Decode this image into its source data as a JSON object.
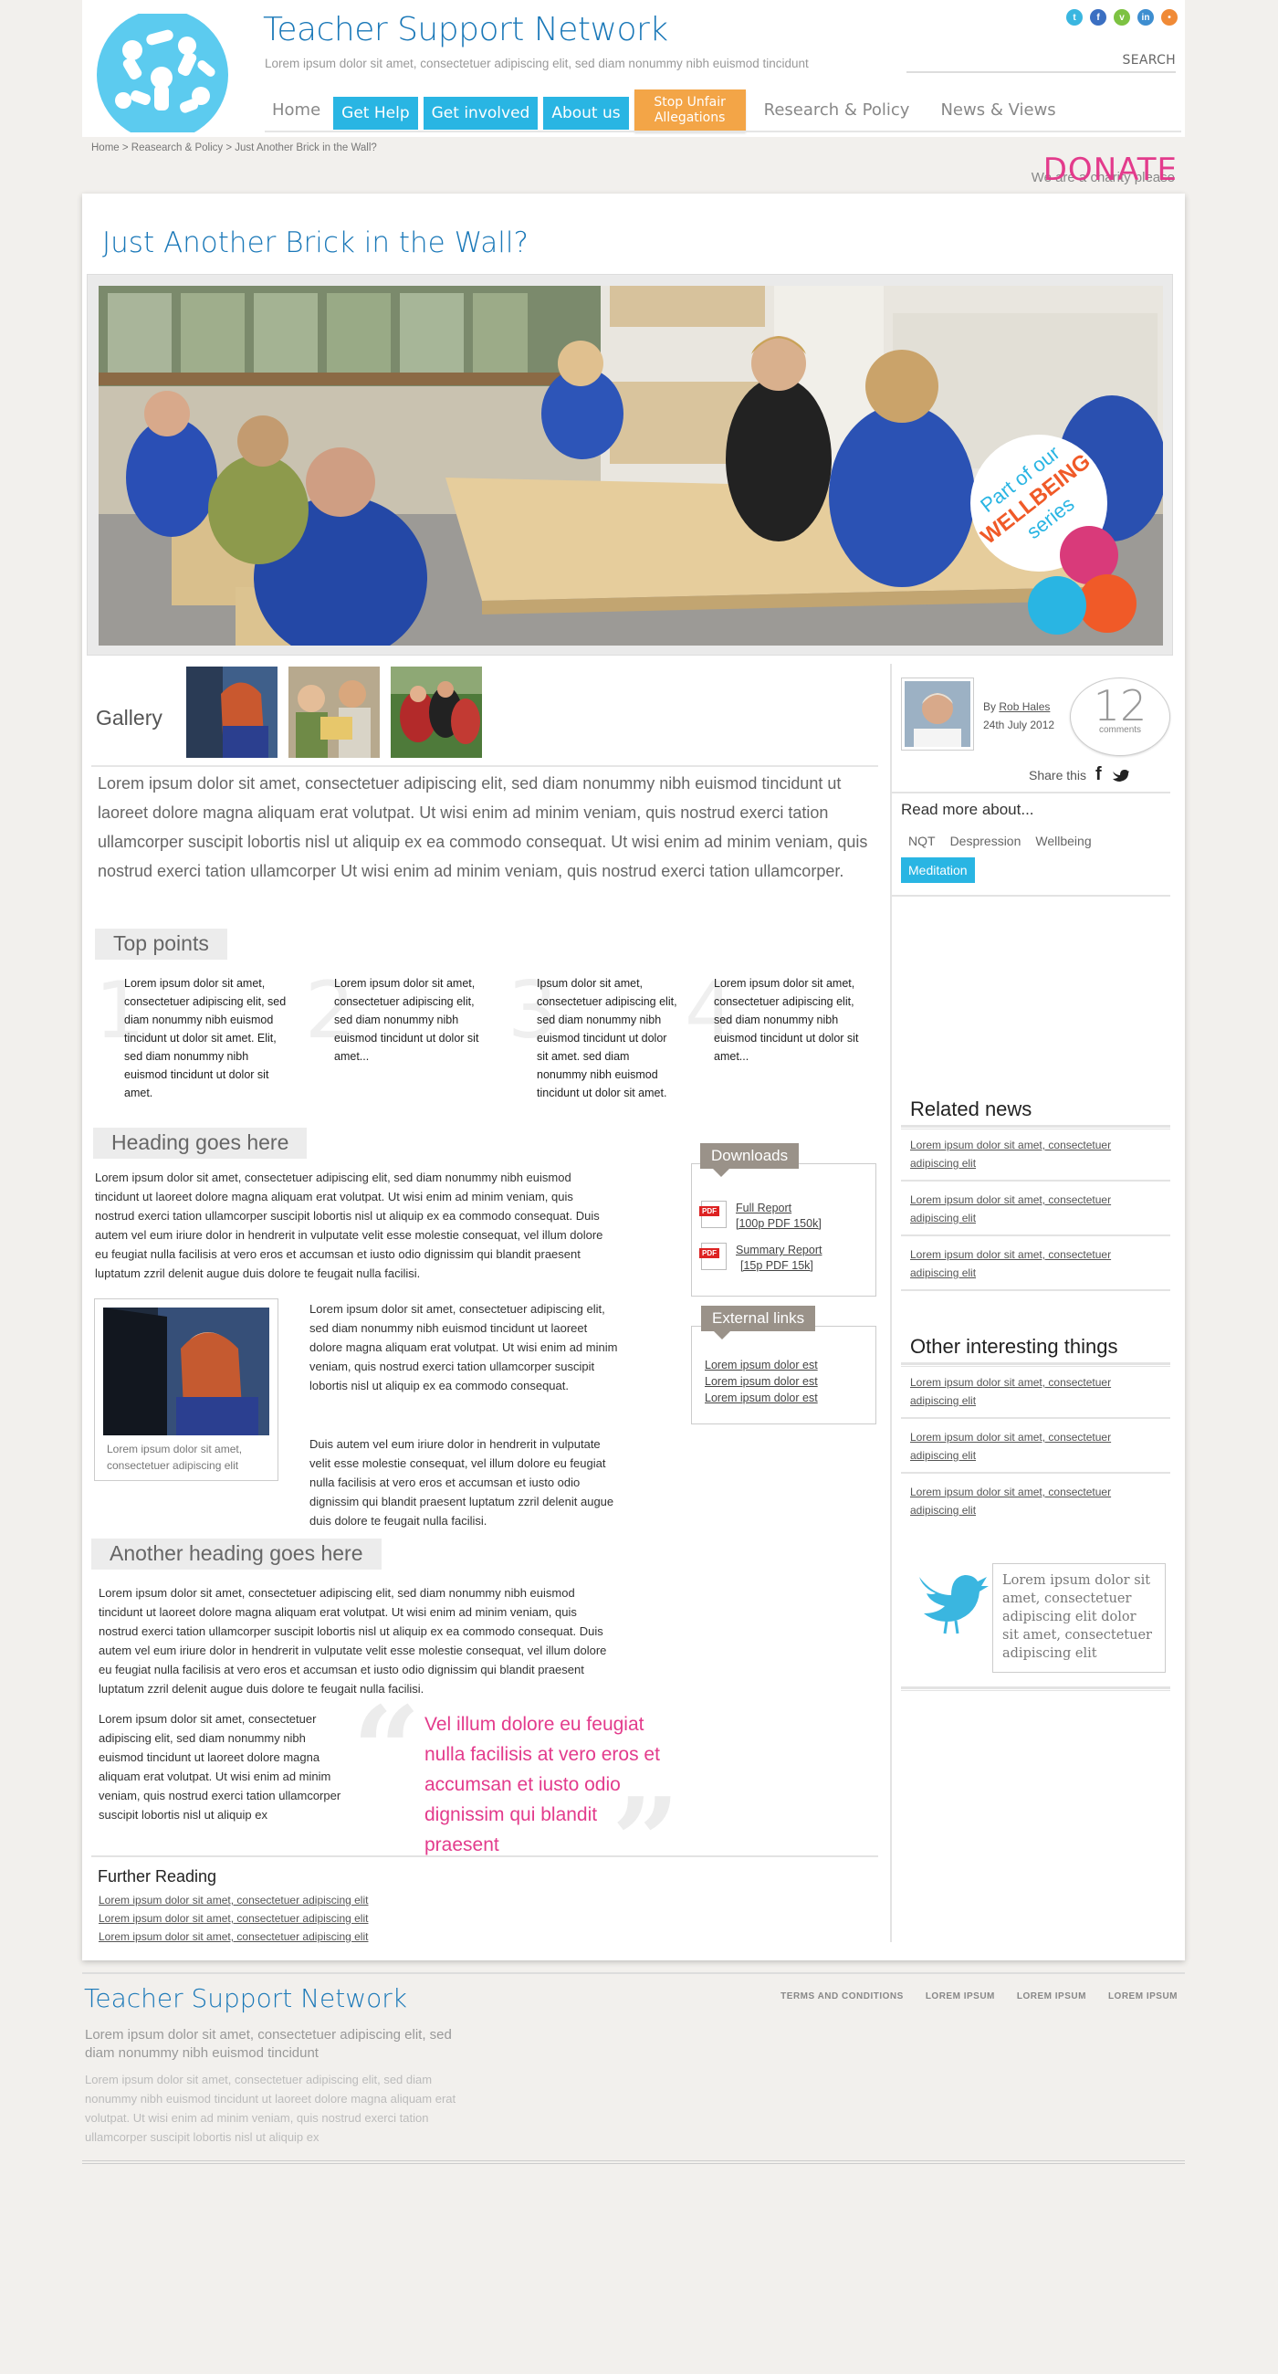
{
  "header": {
    "site_title": "Teacher Support Network",
    "tagline": "Lorem ipsum dolor sit amet, consectetuer adipiscing elit, sed diam nonummy nibh euismod tincidunt",
    "search_label": "SEARCH",
    "social_icons": [
      "twitter-icon",
      "facebook-icon",
      "vimeo-icon",
      "linkedin-icon",
      "rss-icon"
    ],
    "nav": [
      {
        "label": "Home",
        "style": "plain"
      },
      {
        "label": "Get Help",
        "style": "blue"
      },
      {
        "label": "Get involved",
        "style": "blue"
      },
      {
        "label": "About us",
        "style": "blue"
      },
      {
        "label": "Stop Unfair Allegations",
        "style": "orange"
      },
      {
        "label": "Research & Policy",
        "style": "plain"
      },
      {
        "label": "News & Views",
        "style": "plain"
      }
    ],
    "breadcrumb": "Home > Reasearch & Policy > Just Another Brick in the Wall?",
    "charity_text": "We are a charity please",
    "donate_label": "DONATE"
  },
  "colors": {
    "brand_blue": "#1a78b8",
    "accent_cyan": "#29b5e3",
    "accent_orange": "#f3a547",
    "accent_pink": "#e33b8c",
    "tag_grey": "#9a9289"
  },
  "article": {
    "title": "Just Another Brick in the Wall?",
    "hero_badge": {
      "line1": "Part of our",
      "line2": "WELLBEING",
      "line3": "series"
    },
    "gallery_label": "Gallery",
    "intro": "Lorem ipsum dolor sit amet, consectetuer adipiscing elit, sed diam nonummy nibh euismod tincidunt ut laoreet dolore magna aliquam erat volutpat. Ut wisi enim ad minim veniam, quis nostrud exerci tation ullamcorper suscipit lobortis nisl ut aliquip ex ea commodo consequat. Ut wisi enim ad minim veniam, quis nostrud exerci tation ullamcorper Ut wisi enim ad minim veniam, quis nostrud exerci tation ullamcorper.",
    "top_points_heading": "Top points",
    "top_points": [
      {
        "num": "1",
        "text": "Lorem ipsum dolor sit amet, consectetuer adipiscing elit, sed diam nonummy nibh euismod tincidunt ut  dolor sit amet. Elit, sed diam nonummy nibh euismod tincidunt ut dolor sit amet."
      },
      {
        "num": "2",
        "text": "Lorem ipsum dolor sit amet, consectetuer adipiscing elit, sed diam nonummy nibh euismod tincidunt ut  dolor sit amet..."
      },
      {
        "num": "3",
        "text": "Ipsum dolor sit amet, consectetuer adipiscing elit, sed diam nonummy nibh euismod tincidunt ut  dolor sit amet.  sed diam nonummy nibh euismod tincidunt ut  dolor sit amet."
      },
      {
        "num": "4",
        "text": "Lorem ipsum dolor sit amet, consectetuer adipiscing elit, sed diam nonummy nibh euismod tincidunt ut  dolor sit amet..."
      }
    ],
    "heading_2": "Heading goes here",
    "para_2": "Lorem ipsum dolor sit amet, consectetuer adipiscing elit, sed diam nonummy nibh euismod tincidunt ut laoreet dolore magna aliquam erat volutpat. Ut wisi enim ad minim veniam, quis nostrud exerci tation ullamcorper suscipit lobortis nisl ut aliquip ex ea commodo consequat. Duis autem vel eum iriure dolor in hendrerit in vulputate velit esse molestie consequat, vel illum dolore eu feugiat nulla facilisis at vero eros et accumsan et iusto odio dignissim qui blandit praesent luptatum zzril delenit augue duis dolore te feugait nulla facilisi.",
    "figure_caption": "Lorem ipsum dolor sit amet, consectetuer adipiscing elit",
    "para_3a": "Lorem ipsum dolor sit amet, consectetuer adipiscing elit, sed diam nonummy nibh euismod tincidunt ut laoreet dolore magna aliquam erat volutpat. Ut wisi enim ad minim veniam, quis nostrud exerci tation ullamcorper suscipit lobortis nisl ut aliquip ex ea commodo consequat.",
    "para_3b": "Duis autem vel eum iriure dolor in hendrerit in vulputate velit esse molestie consequat, vel illum dolore eu feugiat nulla facilisis at vero eros et accumsan et iusto odio dignissim qui blandit praesent luptatum zzril delenit augue duis dolore te feugait nulla facilisi.",
    "heading_3": "Another heading goes here",
    "para_4": "Lorem ipsum dolor sit amet, consectetuer adipiscing elit, sed diam nonummy nibh euismod tincidunt ut laoreet dolore magna aliquam erat volutpat. Ut wisi enim ad minim veniam, quis nostrud exerci tation ullamcorper suscipit lobortis nisl ut aliquip ex ea commodo consequat. Duis autem vel eum iriure dolor in hendrerit in vulputate velit esse molestie consequat, vel illum dolore eu feugiat nulla facilisis at vero eros et accumsan et iusto odio dignissim qui blandit praesent luptatum zzril delenit augue duis dolore te feugait nulla facilisi.",
    "para_5": "Lorem ipsum dolor sit amet, consectetuer adipiscing elit, sed diam nonummy nibh euismod tincidunt ut laoreet dolore magna aliquam erat volutpat. Ut wisi enim ad minim veniam, quis nostrud exerci tation ullamcorper suscipit lobortis nisl ut aliquip ex",
    "pull_quote": "Vel illum dolore eu feugiat nulla facilisis at vero eros et accumsan et iusto odio dignissim qui blandit praesent",
    "further_reading_title": "Further Reading",
    "further_reading": [
      "Lorem ipsum dolor sit amet, consectetuer adipiscing elit",
      "Lorem ipsum dolor sit amet, consectetuer adipiscing elit",
      "Lorem ipsum dolor sit amet, consectetuer adipiscing elit"
    ]
  },
  "downloads": {
    "label": "Downloads",
    "items": [
      {
        "title": "Full Report",
        "meta": "[100p PDF 150k]"
      },
      {
        "title": "Summary Report",
        "meta": "[15p PDF 15k]"
      }
    ],
    "pdf_badge": "PDF"
  },
  "external_links": {
    "label": "External links",
    "items": [
      "Lorem ipsum dolor est",
      "Lorem ipsum dolor est",
      "Lorem ipsum dolor est"
    ]
  },
  "sidebar": {
    "author_prefix": "By",
    "author": "Rob Hales",
    "date": "24th July 2012",
    "comment_count": "12",
    "comment_label": "comments",
    "share_label": "Share this",
    "read_more_label": "Read more about...",
    "tags": [
      {
        "label": "NQT",
        "active": false
      },
      {
        "label": "Despression",
        "active": false
      },
      {
        "label": "Wellbeing",
        "active": false
      },
      {
        "label": "Meditation",
        "active": true
      }
    ],
    "related_heading": "Related news",
    "related": [
      "Lorem ipsum dolor sit amet, consectetuer adipiscing elit",
      "Lorem ipsum dolor sit amet, consectetuer adipiscing elit",
      "Lorem ipsum dolor sit amet, consectetuer adipiscing elit"
    ],
    "other_heading": "Other interesting things",
    "other": [
      "Lorem ipsum dolor sit amet, consectetuer adipiscing elit",
      "Lorem ipsum dolor sit amet, consectetuer adipiscing elit",
      "Lorem ipsum dolor sit amet, consectetuer adipiscing elit"
    ],
    "tweet": "Lorem ipsum dolor sit amet, consectetuer adipiscing elit dolor sit amet, consectetuer adipiscing elit"
  },
  "footer": {
    "title": "Teacher Support Network",
    "subtitle": "Lorem ipsum dolor sit amet, consectetuer adipiscing elit, sed diam nonummy nibh euismod tincidunt",
    "body": "Lorem ipsum dolor sit amet, consectetuer adipiscing elit, sed diam nonummy nibh euismod tincidunt ut laoreet dolore magna aliquam erat volutpat. Ut wisi enim ad minim veniam, quis nostrud exerci tation ullamcorper suscipit lobortis nisl ut aliquip ex",
    "links": [
      "TERMS AND CONDITIONS",
      "LOREM IPSUM",
      "LOREM IPSUM",
      "LOREM IPSUM"
    ]
  }
}
